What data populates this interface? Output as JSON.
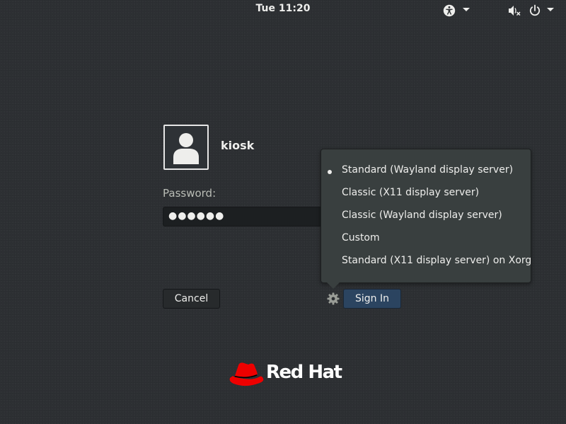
{
  "topbar": {
    "clock": "Tue 11:20",
    "icons": [
      "accessibility-icon",
      "volume-muted-icon",
      "power-icon"
    ]
  },
  "login": {
    "username": "kiosk",
    "password_label": "Password:",
    "password_value": "●●●●●●",
    "cancel_label": "Cancel",
    "signin_label": "Sign In"
  },
  "session_menu": {
    "items": [
      {
        "label": "Standard (Wayland display server)",
        "selected": true
      },
      {
        "label": "Classic (X11 display server)",
        "selected": false
      },
      {
        "label": "Classic (Wayland display server)",
        "selected": false
      },
      {
        "label": "Custom",
        "selected": false
      },
      {
        "label": "Standard (X11 display server) on Xorg",
        "selected": false
      }
    ]
  },
  "branding": {
    "logo_text": "Red Hat",
    "brand_color": "#ee0000"
  },
  "colors": {
    "background": "#2d3033",
    "signin_button": "#2b4460",
    "menu_background": "#393f3f"
  }
}
